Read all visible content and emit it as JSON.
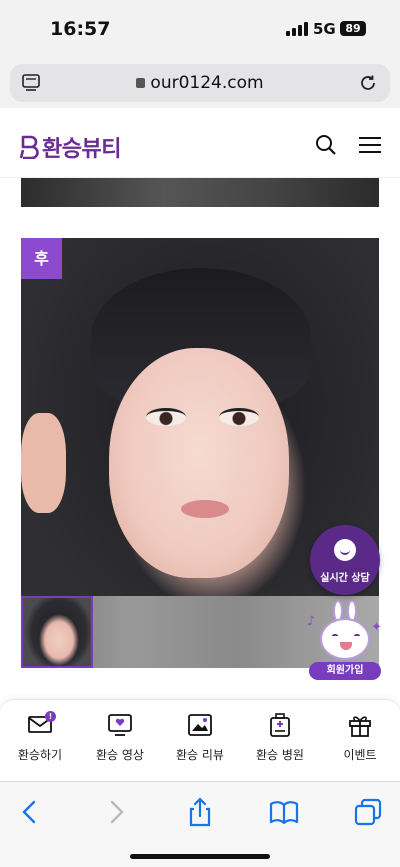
{
  "status_bar": {
    "time": "16:57",
    "network": "5G",
    "battery": "89"
  },
  "browser": {
    "url": "our0124.com"
  },
  "site": {
    "brand_name": "환승뷰티",
    "brand_color": "#6b2a94",
    "accent_color": "#8b4ad0"
  },
  "content": {
    "after_badge": "후"
  },
  "floating": {
    "chat_label": "실시간 상담",
    "signup_label": "회원가입"
  },
  "bottom_nav": {
    "items": [
      {
        "label": "환승하기",
        "icon": "message-icon",
        "badge": "!"
      },
      {
        "label": "환승 영상",
        "icon": "video-heart-icon"
      },
      {
        "label": "환승 리뷰",
        "icon": "photo-review-icon"
      },
      {
        "label": "환승 병원",
        "icon": "hospital-icon"
      },
      {
        "label": "이벤트",
        "icon": "gift-icon"
      }
    ]
  },
  "safari_toolbar": {
    "icons": [
      "back-icon",
      "forward-icon",
      "share-icon",
      "bookmarks-icon",
      "tabs-icon"
    ]
  }
}
